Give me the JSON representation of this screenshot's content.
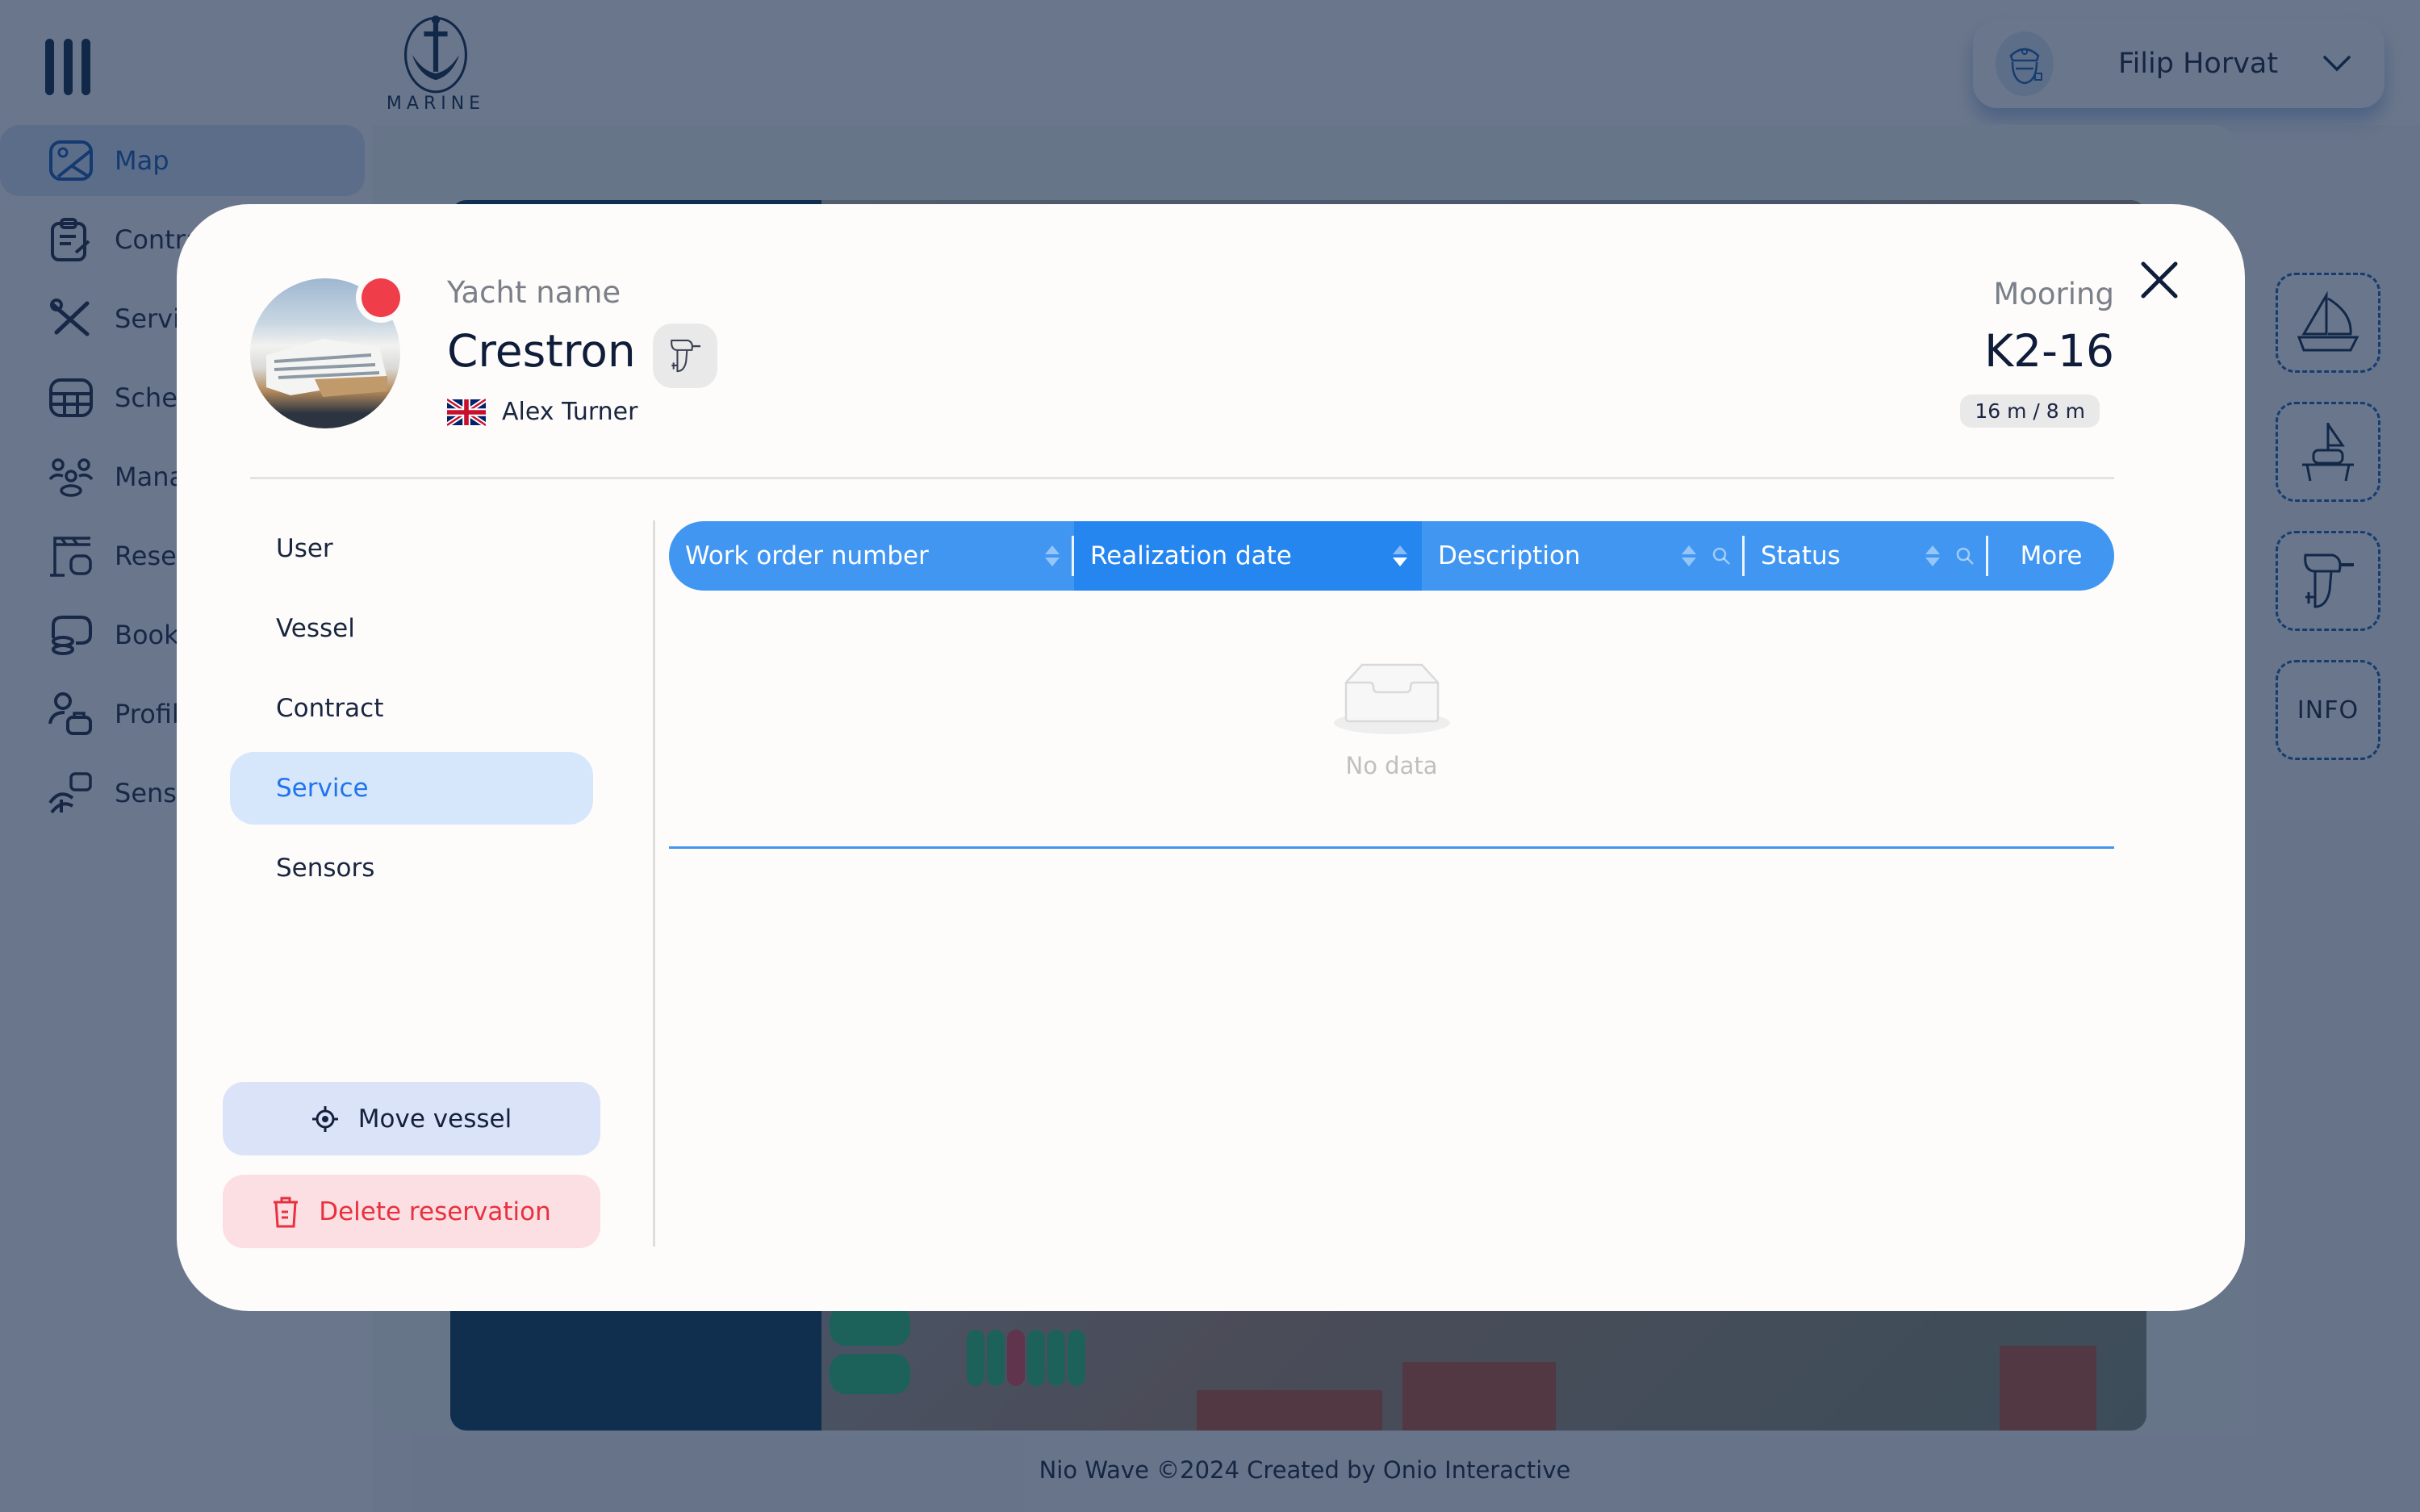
{
  "app": {
    "logo_text": "MARINE",
    "user": {
      "name": "Filip Horvat",
      "avatar_icon": "captain-icon"
    },
    "sidebar": {
      "items": [
        {
          "label": "Map",
          "icon": "map-icon",
          "active": true
        },
        {
          "label": "Contracts",
          "icon": "contract-icon",
          "active": false
        },
        {
          "label": "Services",
          "icon": "tools-icon",
          "active": false
        },
        {
          "label": "Schedule",
          "icon": "calendar-grid-icon",
          "active": false
        },
        {
          "label": "Management",
          "icon": "users-group-icon",
          "active": false
        },
        {
          "label": "Reservations",
          "icon": "crane-icon",
          "active": false
        },
        {
          "label": "Bookkeeping",
          "icon": "coins-icon",
          "active": false
        },
        {
          "label": "Profiles",
          "icon": "user-briefcase-icon",
          "active": false
        },
        {
          "label": "Sensors",
          "icon": "sensor-calendar-icon",
          "active": false
        }
      ]
    },
    "right_tools": [
      {
        "icon": "sailboat-icon"
      },
      {
        "icon": "catamaran-icon"
      },
      {
        "icon": "outboard-motor-icon"
      },
      {
        "label": "INFO"
      }
    ],
    "footer": "Nio Wave ©2024 Created by Onio Interactive"
  },
  "modal": {
    "yacht_label": "Yacht name",
    "yacht_name": "Crestron",
    "status_color": "#ef3e4a",
    "engine_icon": "outboard-motor-icon",
    "owner": {
      "name": "Alex Turner",
      "flag": "GB"
    },
    "mooring_label": "Mooring",
    "mooring_value": "K2-16",
    "dimensions": "16 m / 8 m",
    "nav": [
      {
        "label": "User",
        "active": false
      },
      {
        "label": "Vessel",
        "active": false
      },
      {
        "label": "Contract",
        "active": false
      },
      {
        "label": "Service",
        "active": true
      },
      {
        "label": "Sensors",
        "active": false
      }
    ],
    "actions": {
      "move": "Move vessel",
      "delete": "Delete reservation"
    },
    "table": {
      "columns": [
        {
          "label": "Work order number",
          "sortable": true,
          "searchable": false,
          "sort": "none"
        },
        {
          "label": "Realization date",
          "sortable": true,
          "searchable": false,
          "sort": "descending"
        },
        {
          "label": "Description",
          "sortable": true,
          "searchable": true,
          "sort": "none"
        },
        {
          "label": "Status",
          "sortable": true,
          "searchable": true,
          "sort": "none"
        },
        {
          "label": "More",
          "sortable": false,
          "searchable": false
        }
      ],
      "rows": [],
      "empty_text": "No data"
    },
    "colors": {
      "accent": "#4196f2",
      "active_nav_bg": "#d6e6fb",
      "delete_bg": "#fbdfe2",
      "delete_text": "#e8303e"
    }
  }
}
